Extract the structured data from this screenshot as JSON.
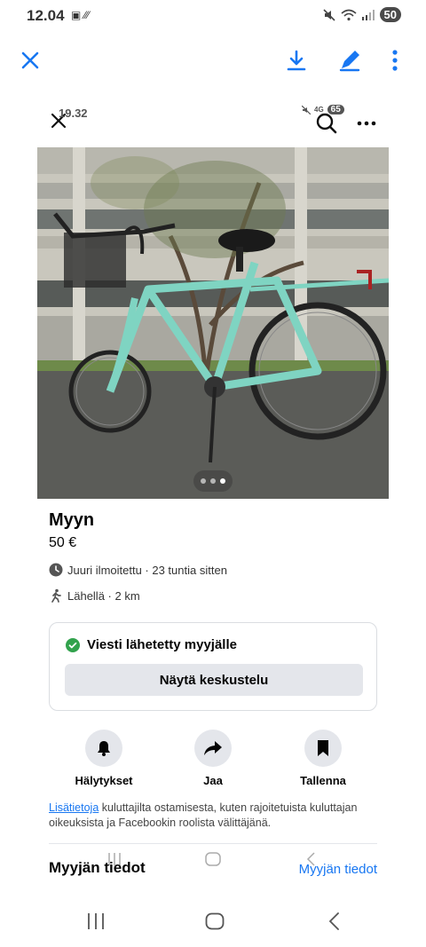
{
  "status_bar": {
    "time": "12.04",
    "left_icons": "▣ ⁄⁄⁄",
    "battery": "50"
  },
  "toolbar": {
    "close_icon": "close-icon",
    "download_icon": "download-icon",
    "edit_icon": "pen-icon",
    "more_icon": "more-vertical-icon",
    "accent_color": "#1877f2"
  },
  "inner_screenshot_status": {
    "time": "19.32",
    "network": "4G",
    "battery": "65"
  },
  "carousel": {
    "total": 3,
    "active_index": 2
  },
  "listing": {
    "title": "Myyn",
    "price": "50 €",
    "posted": "Juuri ilmoitettu · 23 tuntia sitten",
    "distance": "Lähellä · 2 km"
  },
  "message_card": {
    "status_text": "Viesti lähetetty myyjälle",
    "button_label": "Näytä keskustelu",
    "success_color": "#31a24c"
  },
  "actions": [
    {
      "label": "Hälytykset",
      "icon": "bell-icon"
    },
    {
      "label": "Jaa",
      "icon": "share-icon"
    },
    {
      "label": "Tallenna",
      "icon": "bookmark-icon"
    }
  ],
  "info": {
    "link_text": "Lisätietoja",
    "text": " kuluttajilta ostamisesta, kuten rajoitetuista kuluttajan oikeuksista ja Facebookin roolista välittäjänä."
  },
  "seller": {
    "heading": "Myyjän tiedot",
    "link": "Myyjän tiedot"
  },
  "nav": {
    "recents": "recents-icon",
    "home": "home-icon",
    "back": "back-icon"
  }
}
